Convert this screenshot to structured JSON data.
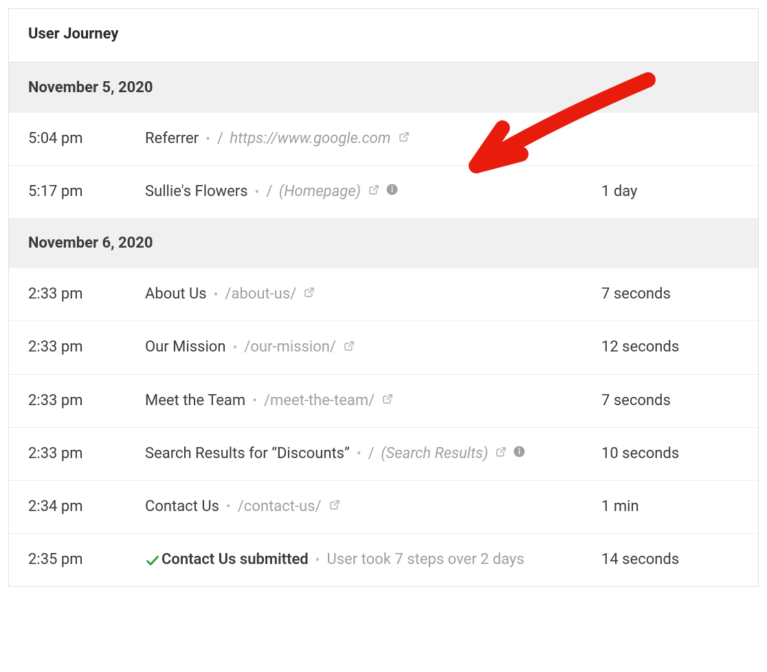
{
  "panel": {
    "title": "User Journey"
  },
  "groups": [
    {
      "date": "November 5, 2020",
      "rows": [
        {
          "time": "5:04 pm",
          "title": "Referrer",
          "slash": "/",
          "path": "https://www.google.com",
          "path_italic": true,
          "ext_link": true,
          "info": false,
          "duration": "",
          "submitted": false,
          "annotation_arrow": false
        },
        {
          "time": "5:17 pm",
          "title": "Sullie's Flowers",
          "slash": "/",
          "path": "(Homepage)",
          "path_italic": true,
          "ext_link": true,
          "info": true,
          "duration": "1 day",
          "submitted": false,
          "annotation_arrow": true
        }
      ]
    },
    {
      "date": "November 6, 2020",
      "rows": [
        {
          "time": "2:33 pm",
          "title": "About Us",
          "slash": "",
          "path": "/about-us/",
          "path_italic": false,
          "ext_link": true,
          "info": false,
          "duration": "7 seconds",
          "submitted": false,
          "annotation_arrow": false
        },
        {
          "time": "2:33 pm",
          "title": "Our Mission",
          "slash": "",
          "path": "/our-mission/",
          "path_italic": false,
          "ext_link": true,
          "info": false,
          "duration": "12 seconds",
          "submitted": false,
          "annotation_arrow": false
        },
        {
          "time": "2:33 pm",
          "title": "Meet the Team",
          "slash": "",
          "path": "/meet-the-team/",
          "path_italic": false,
          "ext_link": true,
          "info": false,
          "duration": "7 seconds",
          "submitted": false,
          "annotation_arrow": false
        },
        {
          "time": "2:33 pm",
          "title": "Search Results for “Discounts”",
          "slash": "/",
          "path": "(Search Results)",
          "path_italic": true,
          "ext_link": true,
          "info": true,
          "duration": "10 seconds",
          "submitted": false,
          "annotation_arrow": false
        },
        {
          "time": "2:34 pm",
          "title": "Contact Us",
          "slash": "",
          "path": "/contact-us/",
          "path_italic": false,
          "ext_link": true,
          "info": false,
          "duration": "1 min",
          "submitted": false,
          "annotation_arrow": false
        },
        {
          "time": "2:35 pm",
          "title": "Contact Us submitted",
          "slash": "",
          "path": "",
          "summary": "User took 7 steps over 2 days",
          "path_italic": false,
          "ext_link": false,
          "info": false,
          "duration": "14 seconds",
          "submitted": true,
          "annotation_arrow": false
        }
      ]
    }
  ]
}
